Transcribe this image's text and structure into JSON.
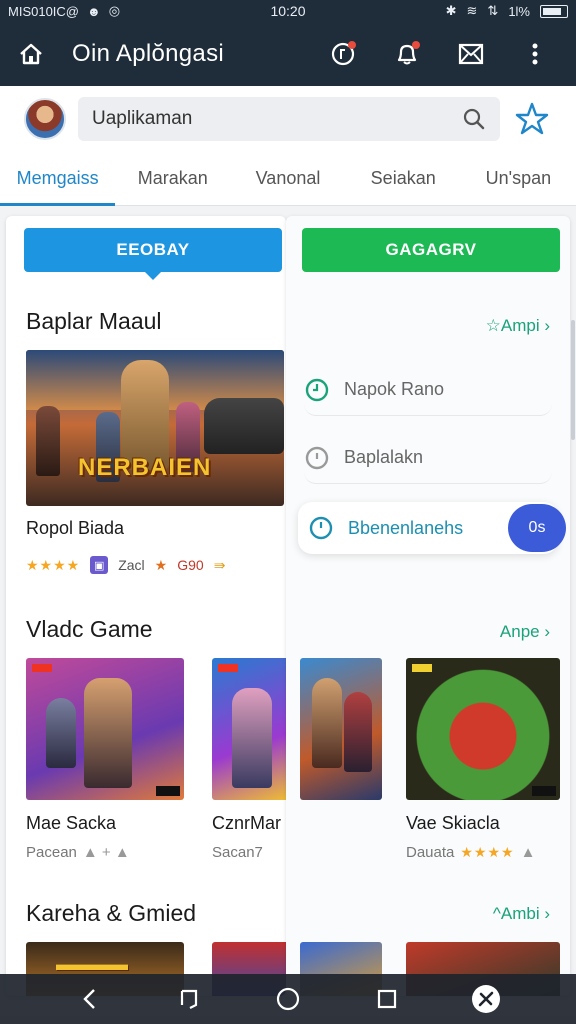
{
  "status_bar": {
    "left_text": "MIS010IC@",
    "time": "10:20",
    "battery": "1l%"
  },
  "app_bar": {
    "title": "Oin Aplŏngasi"
  },
  "search": {
    "value": "Uaplikaman"
  },
  "tabs": [
    {
      "label": "Memgaiss",
      "active": true
    },
    {
      "label": "Marakan",
      "active": false
    },
    {
      "label": "Vanonal",
      "active": false
    },
    {
      "label": "Seiakan",
      "active": false
    },
    {
      "label": "Un'span",
      "active": false
    }
  ],
  "left_panel": {
    "primary_button": "EEOBAY",
    "section1": {
      "title": "Baplar Maaul",
      "feature": {
        "logo_text": "NERBAIEN",
        "name": "Ropol Biada",
        "stars": "★★★★",
        "badge_text": "Zacl",
        "price_star": "★",
        "price": "G90",
        "arrow": "⇛"
      }
    },
    "section2": {
      "title": "Vladc Game",
      "items": [
        {
          "name": "Mae Sacka",
          "sub": "Pacean",
          "icons": "▲ + ▲"
        },
        {
          "name": "CznrMar",
          "sub": "Sacan7"
        }
      ]
    },
    "section3": {
      "title": "Kareha & Gmied"
    }
  },
  "right_panel": {
    "primary_button": "GAGAGRV",
    "more1": "☆Ampi ›",
    "list": [
      {
        "label": "Napok Rano",
        "icon": "clock-icon"
      },
      {
        "label": "Baplalakn",
        "icon": "circle-icon"
      },
      {
        "label": "Bbenenlanehs",
        "icon": "clock-icon",
        "pill": "0s"
      }
    ],
    "more2": "Anpe ›",
    "grid": [
      {
        "name": "Vae Skiacla",
        "sub": "Dauata",
        "stars": "★★★★",
        "icon": "▲"
      }
    ],
    "more3": "^Ambi ›"
  },
  "colors": {
    "header": "#1f2c3a",
    "accent_blue": "#1e95e0",
    "accent_green": "#1db954",
    "link_green": "#1aa37a",
    "tab_active": "#1f86c9"
  }
}
